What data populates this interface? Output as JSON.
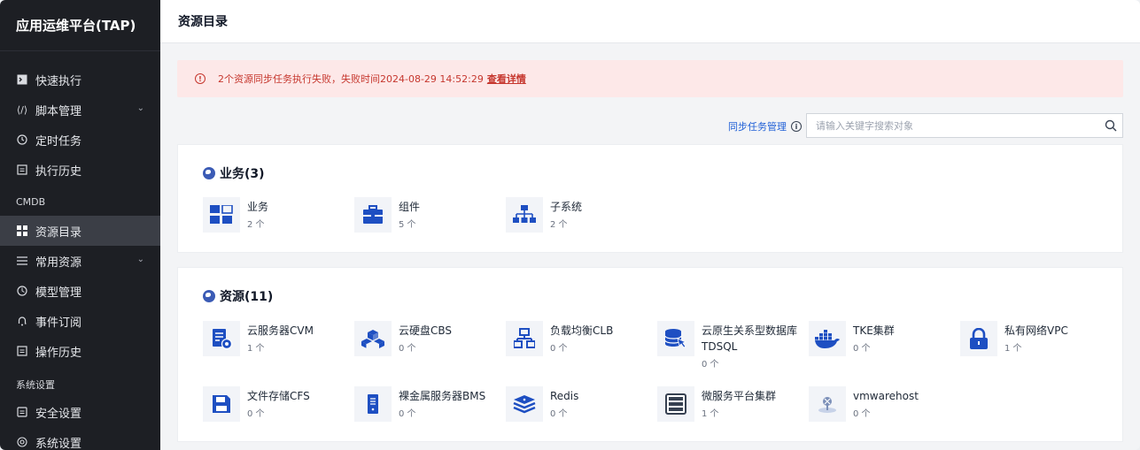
{
  "app": {
    "title": "应用运维平台(TAP)"
  },
  "sidebar": {
    "items": [
      {
        "label": "快速执行",
        "icon": "terminal-icon"
      },
      {
        "label": "脚本管理",
        "icon": "code-icon"
      },
      {
        "label": "定时任务",
        "icon": "clock-icon"
      },
      {
        "label": "执行历史",
        "icon": "history-icon"
      },
      {
        "label": "资源目录",
        "icon": "grid-icon"
      },
      {
        "label": "常用资源",
        "icon": "list-icon"
      },
      {
        "label": "模型管理",
        "icon": "model-icon"
      },
      {
        "label": "事件订阅",
        "icon": "bell-icon"
      },
      {
        "label": "操作历史",
        "icon": "history-icon"
      },
      {
        "label": "安全设置",
        "icon": "shield-icon"
      },
      {
        "label": "系统设置",
        "icon": "settings-icon"
      }
    ],
    "groups": {
      "cmdb": "CMDB",
      "system": "系统设置"
    },
    "active": "资源目录"
  },
  "header": {
    "title": "资源目录"
  },
  "alert": {
    "message": "2个资源同步任务执行失败，失败时间2024-08-29 14:52:29",
    "link": "查看详情",
    "icon": "warning-icon",
    "color": "#c6372e"
  },
  "toolbar": {
    "sync_label": "同步任务管理",
    "search_placeholder": "请输入关键字搜索对象"
  },
  "sections": {
    "business": {
      "title": "业务(3)",
      "items": [
        {
          "name": "业务",
          "count": "2 个",
          "icon": "business-grid-icon"
        },
        {
          "name": "组件",
          "count": "5 个",
          "icon": "toolbox-icon"
        },
        {
          "name": "子系统",
          "count": "2 个",
          "icon": "org-tree-icon"
        }
      ]
    },
    "resources": {
      "title": "资源(11)",
      "items": [
        {
          "name": "云服务器CVM",
          "count": "1 个",
          "icon": "cvm-icon"
        },
        {
          "name": "云硬盘CBS",
          "count": "0 个",
          "icon": "cubes-icon"
        },
        {
          "name": "负载均衡CLB",
          "count": "0 个",
          "icon": "network-icon"
        },
        {
          "name": "云原生关系型数据库TDSQL",
          "count": "0 个",
          "icon": "database-icon"
        },
        {
          "name": "TKE集群",
          "count": "0 个",
          "icon": "docker-icon"
        },
        {
          "name": "私有网络VPC",
          "count": "1 个",
          "icon": "lock-icon"
        },
        {
          "name": "文件存储CFS",
          "count": "0 个",
          "icon": "save-icon"
        },
        {
          "name": "裸金属服务器BMS",
          "count": "0 个",
          "icon": "server-icon"
        },
        {
          "name": "Redis",
          "count": "0 个",
          "icon": "redis-icon"
        },
        {
          "name": "微服务平台集群",
          "count": "1 个",
          "icon": "cluster-icon"
        },
        {
          "name": "vmwarehost",
          "count": "0 个",
          "icon": "vmware-icon"
        }
      ]
    }
  },
  "colors": {
    "accent": "#1f5fd6",
    "sidebar_bg": "#1d1f24",
    "icon_blue": "#1e4fc2"
  }
}
